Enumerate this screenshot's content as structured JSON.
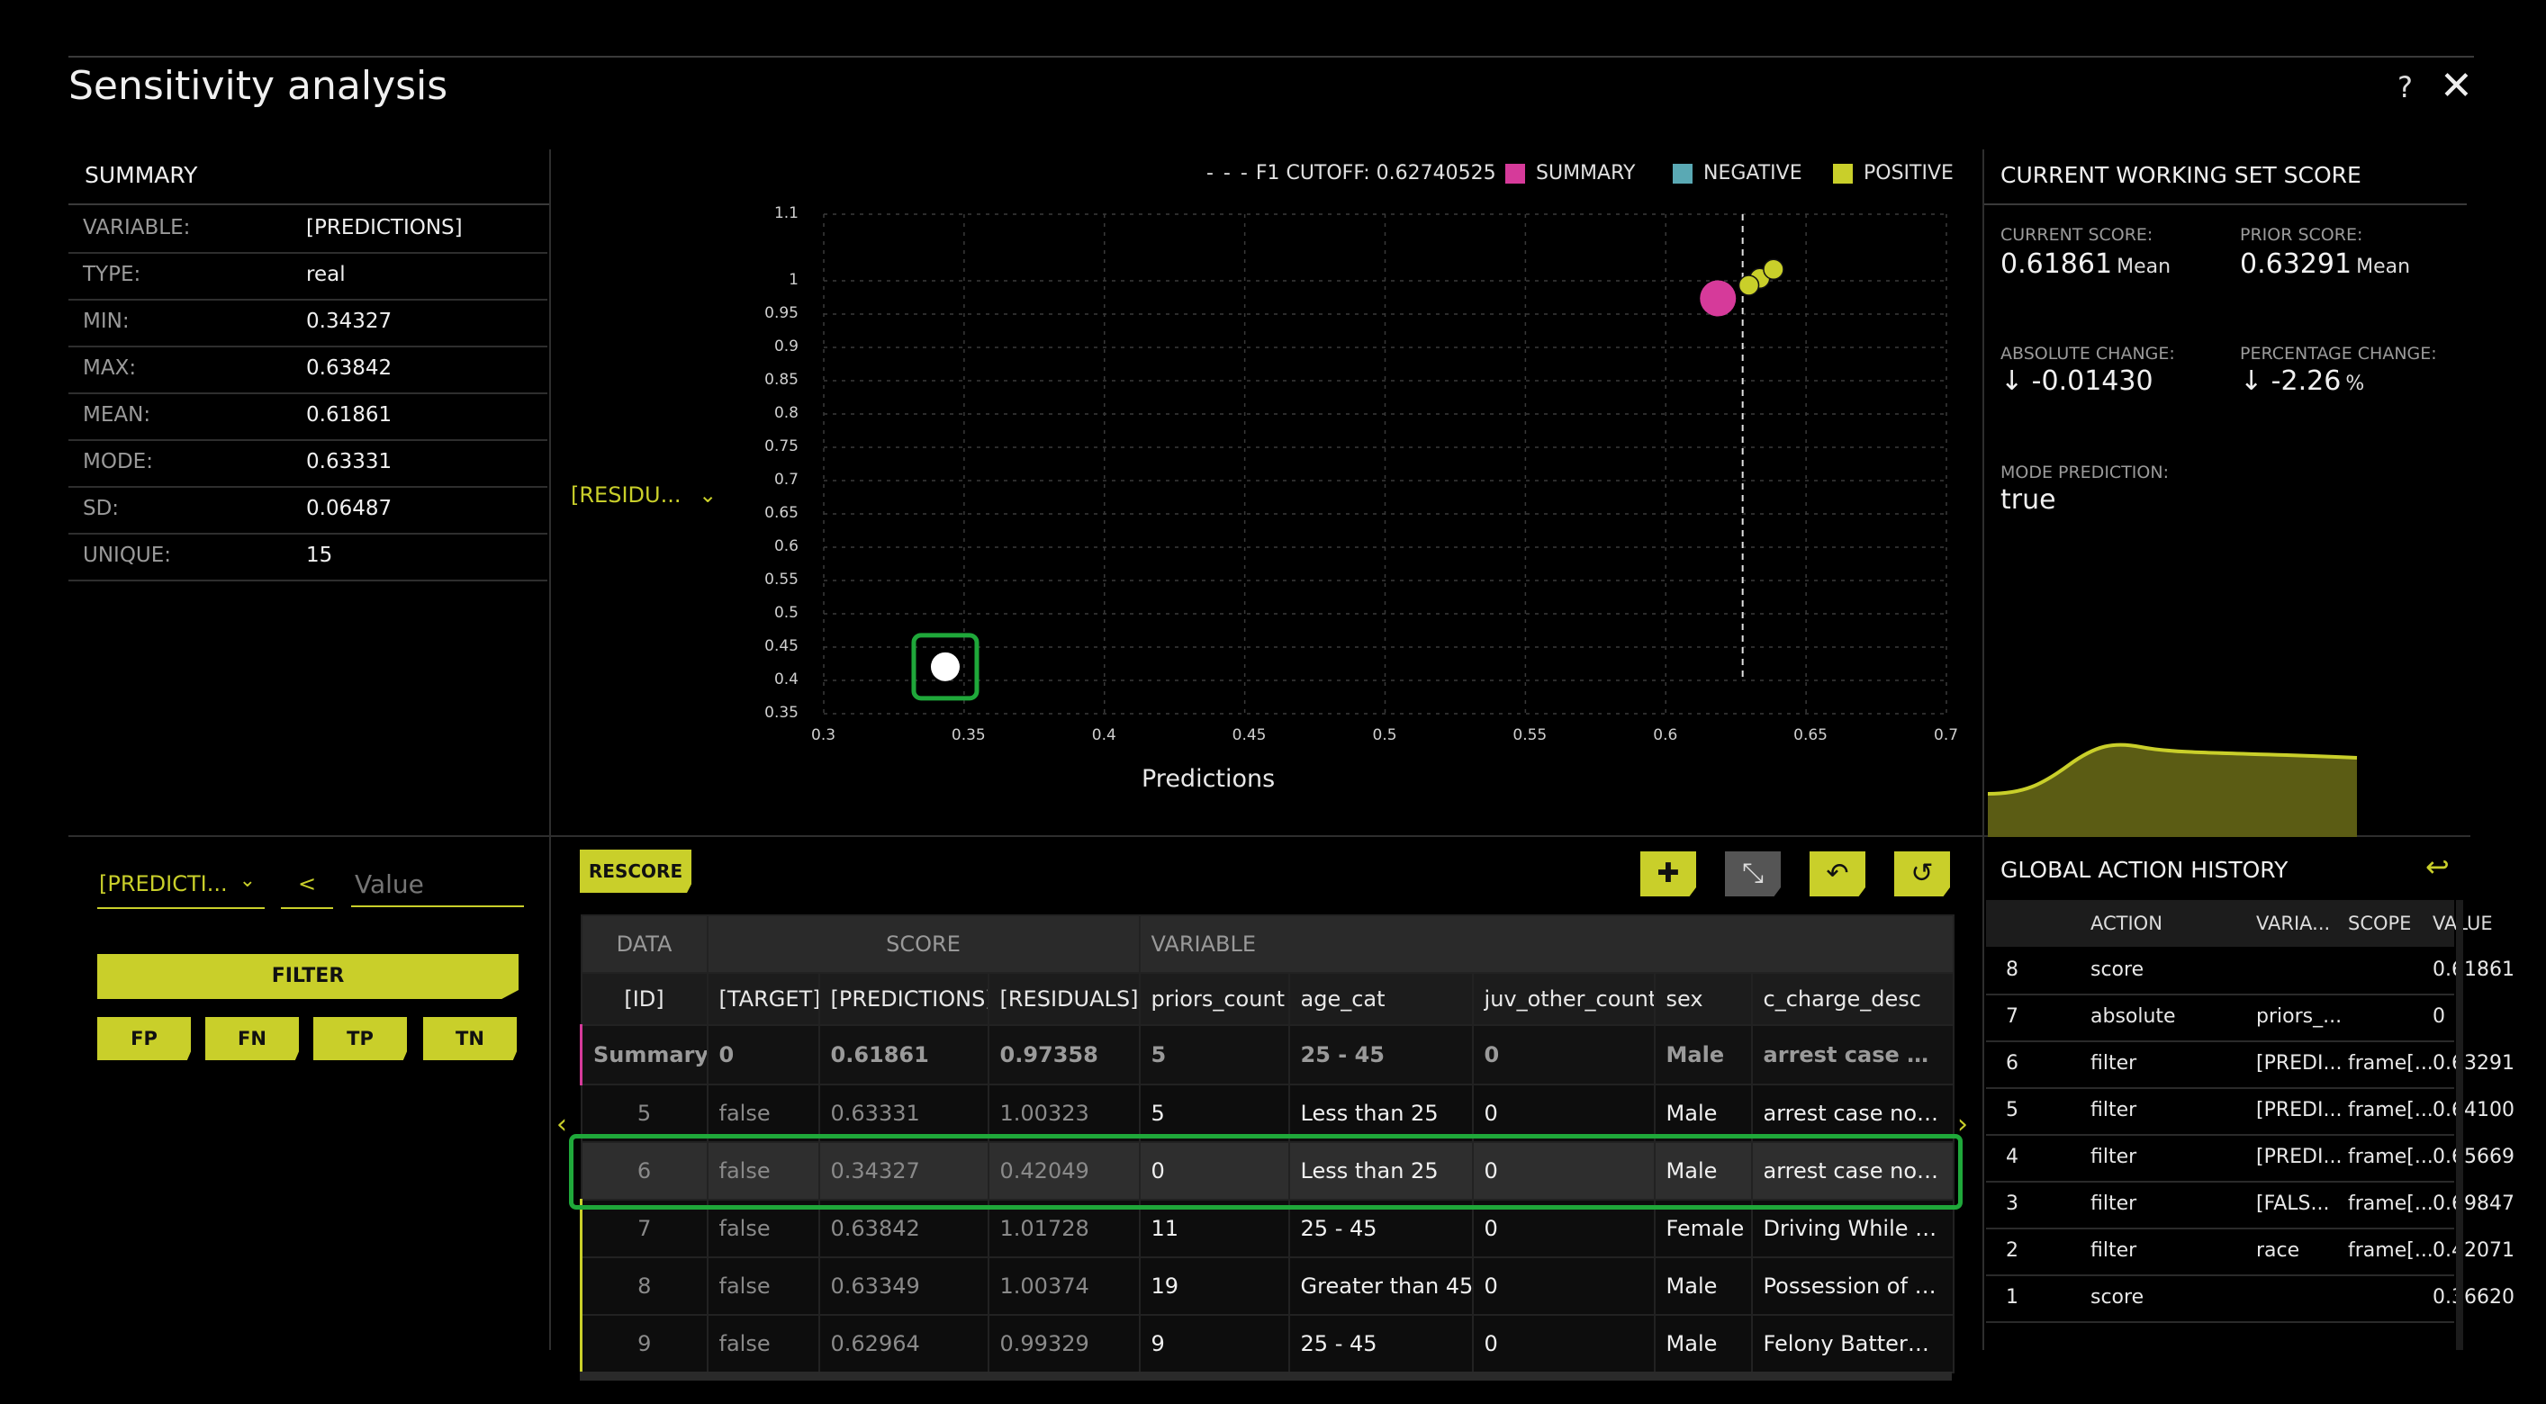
{
  "title": "Sensitivity analysis",
  "header_buttons": {
    "help": "?",
    "close": "✕"
  },
  "summary": {
    "heading": "SUMMARY",
    "rows": [
      {
        "key": "VARIABLE:",
        "value": "[PREDICTIONS]"
      },
      {
        "key": "TYPE:",
        "value": "real"
      },
      {
        "key": "MIN:",
        "value": "0.34327"
      },
      {
        "key": "MAX:",
        "value": "0.63842"
      },
      {
        "key": "MEAN:",
        "value": "0.61861"
      },
      {
        "key": "MODE:",
        "value": "0.63331"
      },
      {
        "key": "SD:",
        "value": "0.06487"
      },
      {
        "key": "UNIQUE:",
        "value": "15"
      }
    ]
  },
  "filter": {
    "variable": "[PREDICTI...",
    "operator": "<",
    "value_placeholder": "Value",
    "filter_label": "FILTER",
    "quick": [
      "FP",
      "FN",
      "TP",
      "TN"
    ]
  },
  "chart_data": {
    "type": "scatter",
    "xlabel": "Predictions",
    "ylabel_selector": "[RESIDU...",
    "xlim": [
      0.3,
      0.7
    ],
    "ylim": [
      0.35,
      1.1
    ],
    "x_ticks": [
      "0.3",
      "0.35",
      "0.4",
      "0.45",
      "0.5",
      "0.55",
      "0.6",
      "0.65",
      "0.7"
    ],
    "y_ticks": [
      "1.1",
      "1",
      "0.95",
      "0.9",
      "0.85",
      "0.8",
      "0.75",
      "0.7",
      "0.65",
      "0.6",
      "0.55",
      "0.5",
      "0.45",
      "0.4",
      "0.35"
    ],
    "cutoff_label": "F1 CUTOFF: 0.62740525",
    "cutoff_x": 0.6274,
    "legend": [
      {
        "name": "SUMMARY",
        "color": "#d63a9a"
      },
      {
        "name": "NEGATIVE",
        "color": "#5aa9b4"
      },
      {
        "name": "POSITIVE",
        "color": "#c9cf2a"
      }
    ],
    "series": [
      {
        "name": "SUMMARY",
        "points": [
          [
            0.6186,
            0.9736
          ]
        ]
      },
      {
        "name": "POSITIVE",
        "points": [
          [
            0.6333,
            1.0032
          ],
          [
            0.6335,
            1.0037
          ],
          [
            0.6296,
            0.9933
          ],
          [
            0.6384,
            1.0173
          ]
        ]
      },
      {
        "name": "SELECTED",
        "points": [
          [
            0.3433,
            0.4205
          ]
        ]
      }
    ],
    "grid": true
  },
  "toolbar": {
    "rescore": "RESCORE",
    "icons": [
      "plus-icon",
      "collapse-icon",
      "undo-icon",
      "reset-icon"
    ],
    "icon_glyphs": [
      "✚",
      "⤡",
      "↶",
      "↺"
    ]
  },
  "table": {
    "groups": [
      "DATA",
      "SCORE",
      "VARIABLE"
    ],
    "columns": [
      "[ID]",
      "[TARGET]",
      "[PREDICTIONS]",
      "[RESIDUALS]",
      "priors_count",
      "age_cat",
      "juv_other_count",
      "sex",
      "c_charge_desc"
    ],
    "rows": [
      [
        "Summary",
        "0",
        "0.61861",
        "0.97358",
        "5",
        "25 - 45",
        "0",
        "Male",
        "arrest case no c..."
      ],
      [
        "5",
        "false",
        "0.63331",
        "1.00323",
        "5",
        "Less than 25",
        "0",
        "Male",
        "arrest case no c..."
      ],
      [
        "6",
        "false",
        "0.34327",
        "0.42049",
        "0",
        "Less than 25",
        "0",
        "Male",
        "arrest case no c..."
      ],
      [
        "7",
        "false",
        "0.63842",
        "1.01728",
        "11",
        "25 - 45",
        "0",
        "Female",
        "Driving While Lic..."
      ],
      [
        "8",
        "false",
        "0.63349",
        "1.00374",
        "19",
        "Greater than 45",
        "0",
        "Male",
        "Possession of Co..."
      ],
      [
        "9",
        "false",
        "0.62964",
        "0.99329",
        "9",
        "25 - 45",
        "0",
        "Male",
        "Felony Battery w..."
      ]
    ]
  },
  "working_set": {
    "heading": "CURRENT WORKING SET SCORE",
    "current_label": "CURRENT SCORE:",
    "current_value": "0.61861",
    "current_unit": "Mean",
    "prior_label": "PRIOR SCORE:",
    "prior_value": "0.63291",
    "prior_unit": "Mean",
    "abs_label": "ABSOLUTE CHANGE:",
    "abs_value": "↓ -0.01430",
    "pct_label": "PERCENTAGE CHANGE:",
    "pct_value": "↓ -2.26",
    "pct_unit": "%",
    "mode_label": "MODE PREDICTION:",
    "mode_value": "true"
  },
  "history": {
    "heading": "GLOBAL ACTION HISTORY",
    "columns": [
      "ACTION",
      "VARIA...",
      "SCOPE",
      "VALUE"
    ],
    "rows": [
      [
        "8",
        "score",
        "",
        "",
        "0.61861"
      ],
      [
        "7",
        "absolute",
        "priors_...",
        "",
        "0"
      ],
      [
        "6",
        "filter",
        "[PREDI...",
        "frame[...",
        "0.63291"
      ],
      [
        "5",
        "filter",
        "[PREDI...",
        "frame[...",
        "0.64100"
      ],
      [
        "4",
        "filter",
        "[PREDI...",
        "frame[...",
        "0.65669"
      ],
      [
        "3",
        "filter",
        "[FALS...",
        "frame[...",
        "0.69847"
      ],
      [
        "2",
        "filter",
        "race",
        "frame[...",
        "0.42071"
      ],
      [
        "1",
        "score",
        "",
        "",
        "0.36620"
      ]
    ]
  },
  "colors": {
    "accent": "#c9cf2a",
    "summary": "#d63a9a",
    "negative": "#5aa9b4",
    "selection": "#1fa83a"
  }
}
